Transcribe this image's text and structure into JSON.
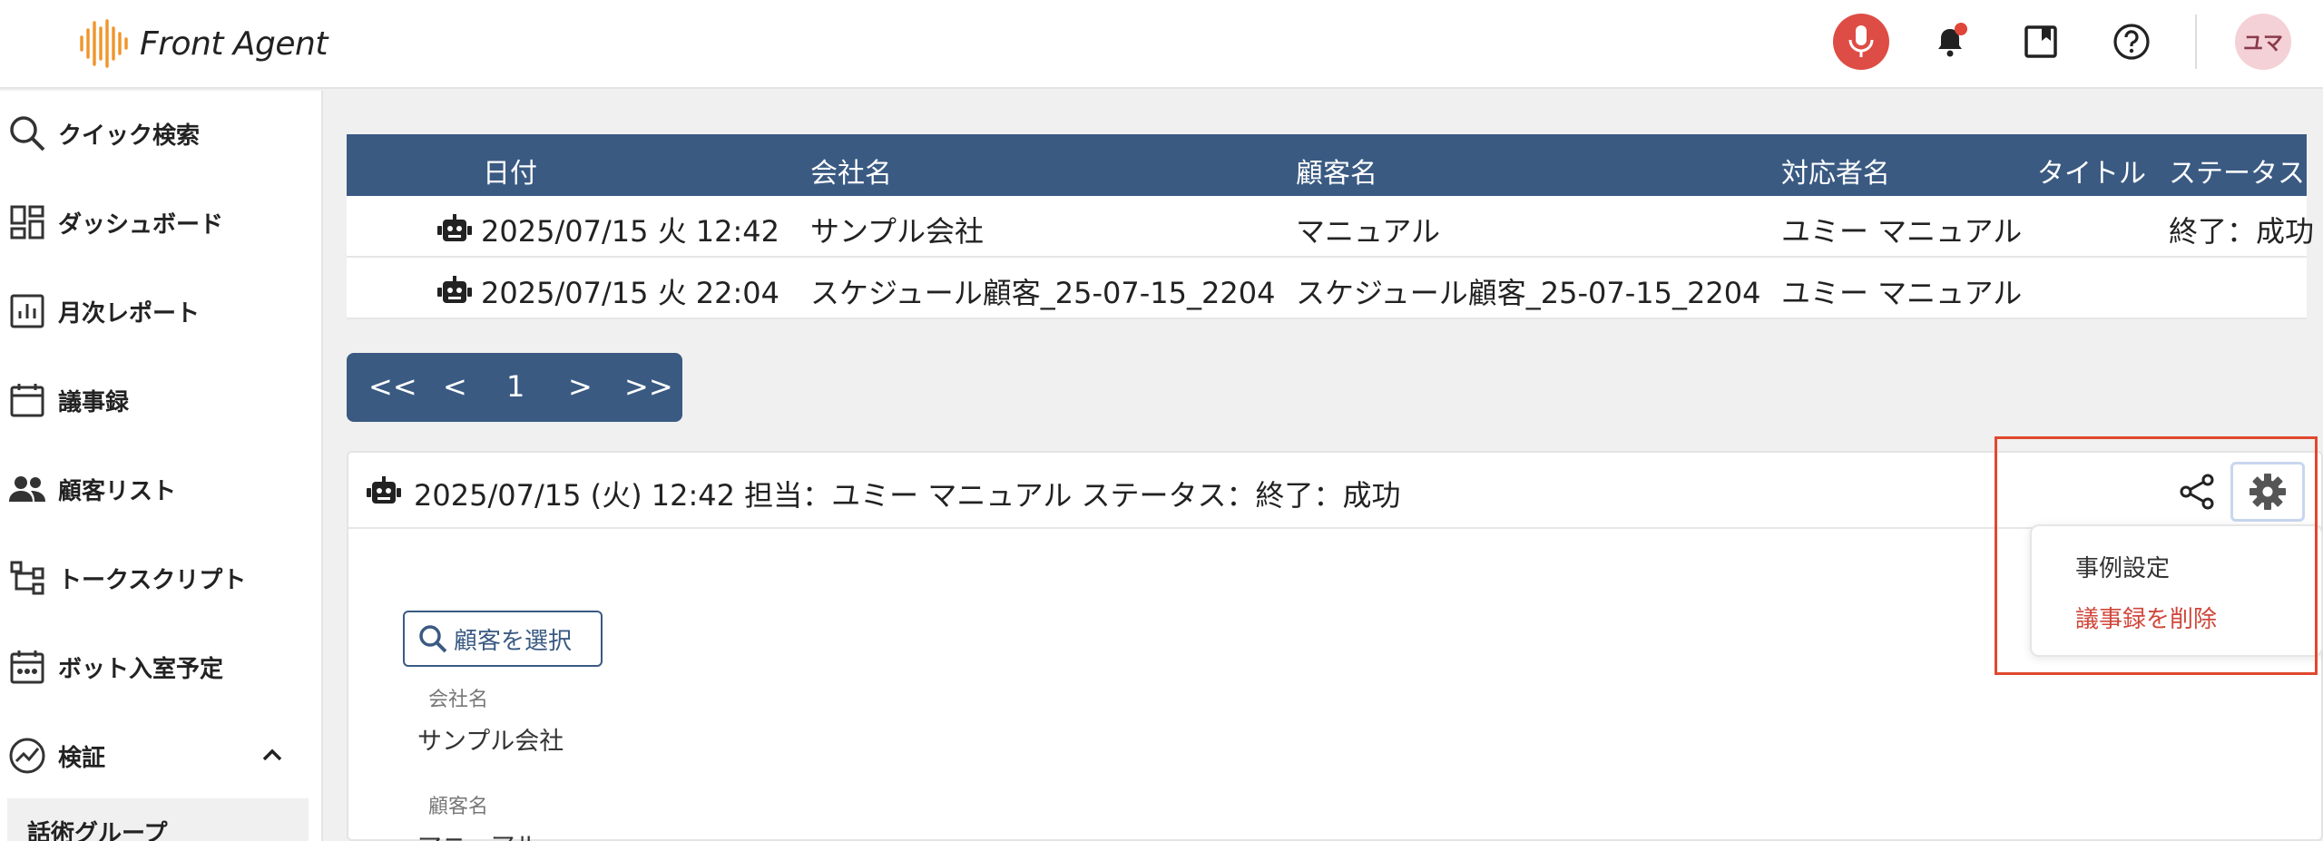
{
  "header": {
    "app_name": "Front Agent",
    "avatar_text": "ユマ",
    "accent_color": "#3a5a82",
    "mic_color": "#de4d45"
  },
  "sidebar": {
    "items": [
      {
        "label": "クイック検索",
        "icon": "search-icon"
      },
      {
        "label": "ダッシュボード",
        "icon": "dashboard-icon"
      },
      {
        "label": "月次レポート",
        "icon": "chart-icon"
      },
      {
        "label": "議事録",
        "icon": "calendar-icon"
      },
      {
        "label": "顧客リスト",
        "icon": "people-icon"
      },
      {
        "label": "トークスクリプト",
        "icon": "tree-icon"
      },
      {
        "label": "ボット入室予定",
        "icon": "calendar-dots-icon"
      },
      {
        "label": "検証",
        "icon": "trend-icon"
      }
    ],
    "sub_item": "話術グループ"
  },
  "table": {
    "columns": [
      "日付",
      "会社名",
      "顧客名",
      "対応者名",
      "タイトル",
      "ステータス"
    ],
    "rows": [
      {
        "date": "2025/07/15 火 12:42",
        "company": "サンプル会社",
        "customer": "マニュアル",
        "agent": "ユミー マニュアル",
        "title": "",
        "status": "終了：成功"
      },
      {
        "date": "2025/07/15 火 22:04",
        "company": "スケジュール顧客_25-07-15_2204",
        "customer": "スケジュール顧客_25-07-15_2204",
        "agent": "ユミー マニュアル",
        "title": "",
        "status": ""
      }
    ]
  },
  "pager": {
    "first": "<<",
    "prev": "<",
    "page": "1",
    "next": ">",
    "last": ">>"
  },
  "detail": {
    "title": "2025/07/15 (火) 12:42 担当：ユミー マニュアル ステータス：終了：成功",
    "select_customer": "顧客を選択",
    "company_label": "会社名",
    "company_value": "サンプル会社",
    "customer_label": "顧客名",
    "customer_value": "マニュアル"
  },
  "menu": {
    "items": [
      "事例設定",
      "議事録を削除"
    ],
    "danger_color": "#d0473b"
  }
}
